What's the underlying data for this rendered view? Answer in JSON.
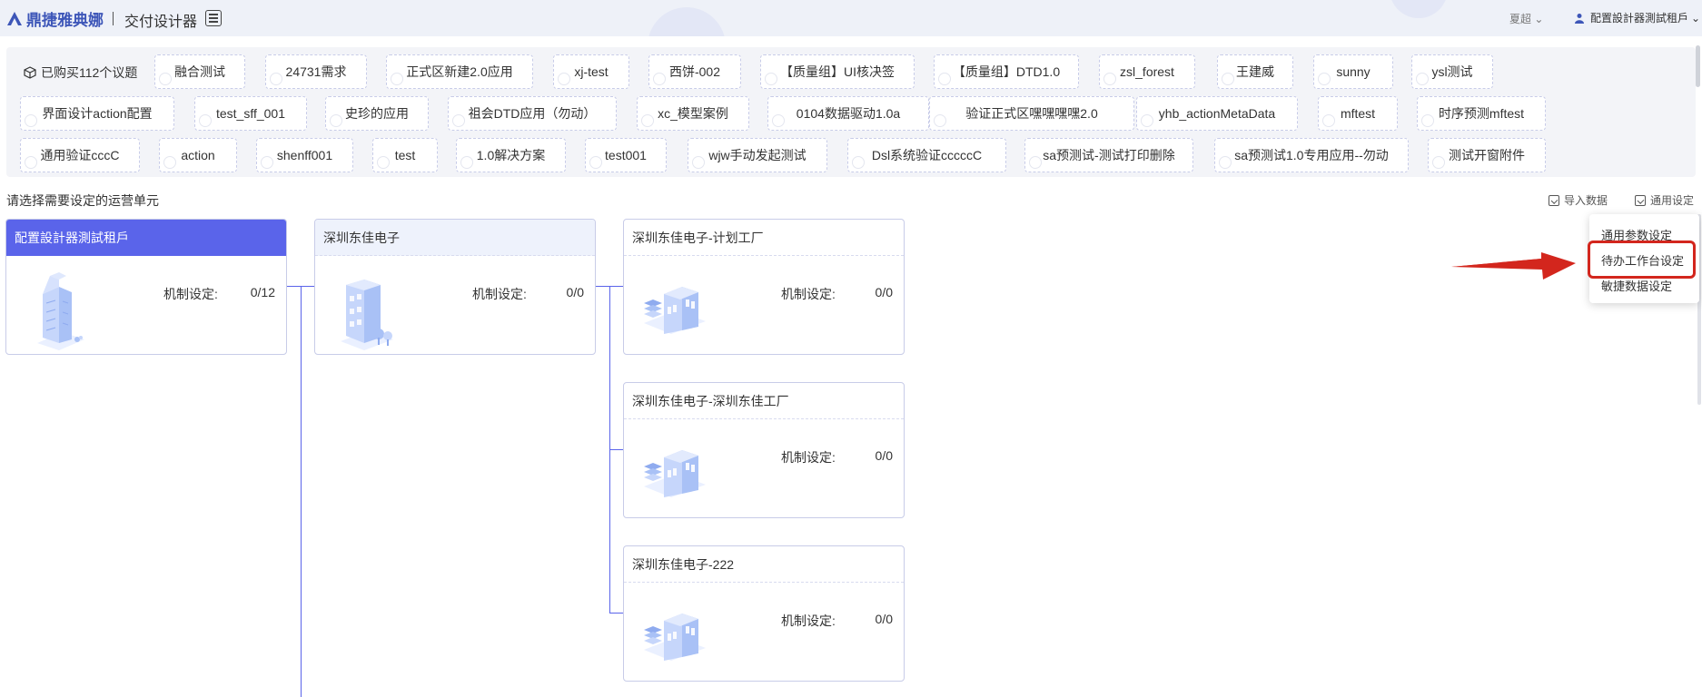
{
  "header": {
    "logo_text": "鼎捷雅典娜",
    "app_title": "交付设计器",
    "user_name": "夏超",
    "tenant_name": "配置設計器測試租戶"
  },
  "topics": {
    "purchased_label": "已购买112个议题",
    "chips": [
      "融合测试",
      "24731需求",
      "正式区新建2.0应用",
      "xj-test",
      "西饼-002",
      "【质量组】UI核决签",
      "【质量组】DTD1.0",
      "zsl_forest",
      "王建威",
      "sunny",
      "ysl测试",
      "界面设计action配置",
      "test_sff_001",
      "史珍的应用",
      "祖会DTD应用（勿动）",
      "xc_模型案例",
      "0104数据驱动1.0a",
      "验证正式区嘿嘿嘿嘿2.0",
      "yhb_actionMetaData",
      "mftest",
      "时序预测mftest",
      "通用验证cccC",
      "action",
      "shenff001",
      "test",
      "1.0解决方案",
      "test001",
      "wjw手动发起测试",
      "Dsl系统验证cccccC",
      "sa预测试-测试打印删除",
      "sa预测试1.0专用应用--勿动",
      "测试开窗附件"
    ]
  },
  "section": {
    "title": "请选择需要设定的运营单元",
    "import_label": "导入数据",
    "settings_label": "通用设定"
  },
  "dropdown": {
    "items": [
      "通用参数设定",
      "待办工作台设定",
      "敏捷数据设定"
    ],
    "highlighted_index": 1
  },
  "org": {
    "mech_label": "机制设定:",
    "tenant": {
      "name": "配置設計器測試租戶",
      "ratio": "0/12"
    },
    "company": {
      "name": "深圳东佳电子",
      "ratio": "0/0"
    },
    "factories": [
      {
        "name": "深圳东佳电子-计划工厂",
        "ratio": "0/0"
      },
      {
        "name": "深圳东佳电子-深圳东佳工厂",
        "ratio": "0/0"
      },
      {
        "name": "深圳东佳电子-222",
        "ratio": "0/0"
      }
    ]
  },
  "colors": {
    "accent": "#5a64ea",
    "brand": "#3d56b8",
    "highlight_red": "#d3261d"
  }
}
